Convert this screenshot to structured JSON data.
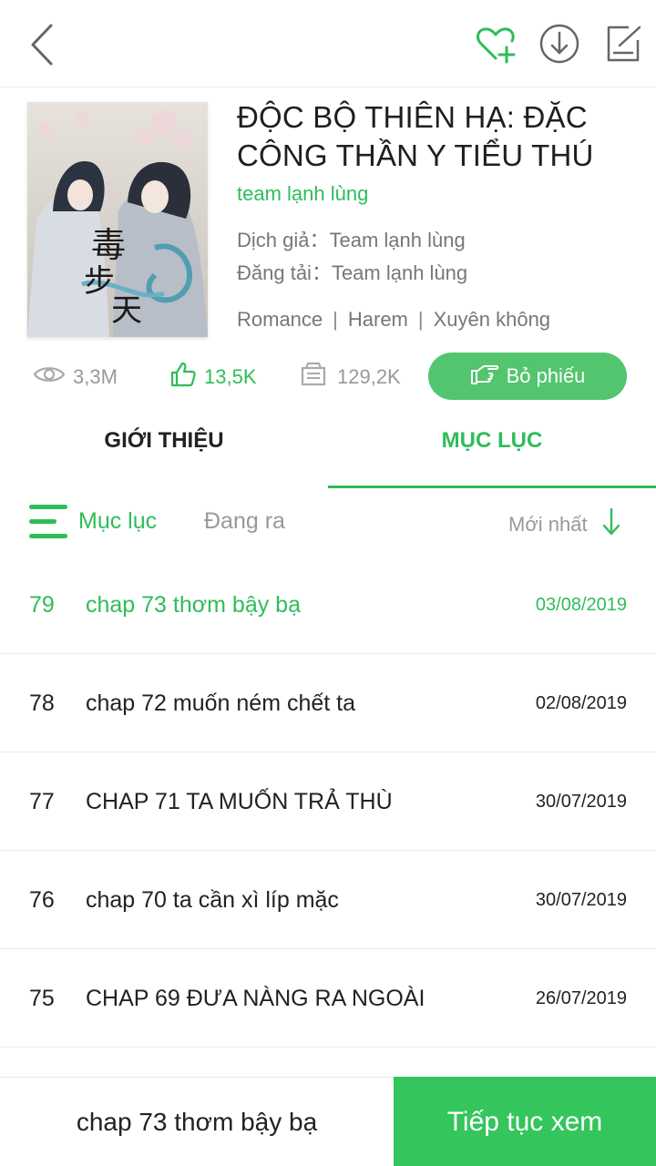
{
  "colors": {
    "accent": "#2ebd59",
    "button": "#52c56e",
    "continue": "#34c55c",
    "muted": "#999999"
  },
  "header": {
    "icons": [
      "back-icon",
      "favorite-add-icon",
      "download-icon",
      "edit-icon"
    ]
  },
  "book": {
    "title": "ĐỘC BỘ THIÊN HẠ: ĐẶC CÔNG THẦN Y TIỂU THÚ",
    "author": "team lạnh lùng",
    "translator_line": "Dịch giả：Team lạnh lùng",
    "uploader_line": "Đăng tải：Team lạnh lùng",
    "genres": [
      "Romance",
      "Harem",
      "Xuyên không"
    ],
    "genre_separator": "|"
  },
  "stats": {
    "views": "3,3M",
    "likes": "13,5K",
    "tickets": "129,2K",
    "vote_label": "Bỏ phiếu"
  },
  "tabs": [
    {
      "label": "GIỚI THIỆU",
      "active": false
    },
    {
      "label": "MỤC LỤC",
      "active": true
    }
  ],
  "filters": {
    "toc_label": "Mục lục",
    "ongoing_label": "Đang ra",
    "sort_label": "Mới nhất"
  },
  "chapters": [
    {
      "num": "79",
      "title": "chap 73 thơm bậy bạ",
      "date": "03/08/2019",
      "active": true
    },
    {
      "num": "78",
      "title": "chap 72 muốn ném chết ta",
      "date": "02/08/2019",
      "active": false
    },
    {
      "num": "77",
      "title": "CHAP 71 TA MUỐN TRẢ THÙ",
      "date": "30/07/2019",
      "active": false
    },
    {
      "num": "76",
      "title": "chap 70 ta cần xì líp mặc",
      "date": "30/07/2019",
      "active": false
    },
    {
      "num": "75",
      "title": "CHAP 69 ĐƯA NÀNG RA NGOÀI",
      "date": "26/07/2019",
      "active": false
    }
  ],
  "bottom": {
    "last_read": "chap 73 thơm bậy bạ",
    "continue_label": "Tiếp tục xem"
  }
}
